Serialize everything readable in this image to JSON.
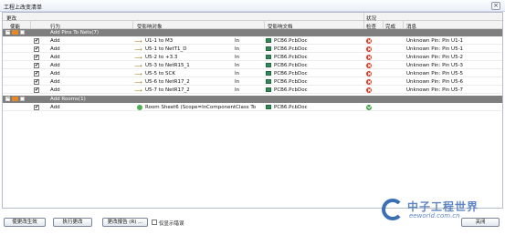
{
  "window": {
    "title": "工程上改变清单",
    "close": "×"
  },
  "header": {
    "modifications": "更改",
    "status": "状况",
    "columns": {
      "enable": "使能",
      "action": "行为",
      "affected_object": "受影响对象",
      "affected_document": "受影响文档",
      "check": "检查",
      "done": "完成",
      "message": "消息"
    }
  },
  "groups": [
    {
      "label": "Add Pins To Nets(7)",
      "toggle": "−",
      "rows": [
        {
          "enabled": "✔",
          "action": "Add",
          "object": "U1-1 to M3",
          "prep": "In",
          "document": "PCB6.PcbDoc",
          "message": "Unknown Pin: Pin U1-1"
        },
        {
          "enabled": "✔",
          "action": "Add",
          "object": "U5-1 to NetT1_D",
          "prep": "In",
          "document": "PCB6.PcbDoc",
          "message": "Unknown Pin: Pin U5-1"
        },
        {
          "enabled": "✔",
          "action": "Add",
          "object": "U5-2 to +3.3",
          "prep": "In",
          "document": "PCB6.PcbDoc",
          "message": "Unknown Pin: Pin U5-2"
        },
        {
          "enabled": "✔",
          "action": "Add",
          "object": "U5-3 to NetR15_1",
          "prep": "In",
          "document": "PCB6.PcbDoc",
          "message": "Unknown Pin: Pin U5-3"
        },
        {
          "enabled": "✔",
          "action": "Add",
          "object": "U5-5 to SCK",
          "prep": "In",
          "document": "PCB6.PcbDoc",
          "message": "Unknown Pin: Pin U5-5"
        },
        {
          "enabled": "✔",
          "action": "Add",
          "object": "U5-6 to NetR17_2",
          "prep": "In",
          "document": "PCB6.PcbDoc",
          "message": "Unknown Pin: Pin U5-6"
        },
        {
          "enabled": "✔",
          "action": "Add",
          "object": "U5-7 to NetR17_2",
          "prep": "In",
          "document": "PCB6.PcbDoc",
          "message": "Unknown Pin: Pin U5-7"
        }
      ]
    },
    {
      "label": "Add Rooms(1)",
      "toggle": "−",
      "rows": [
        {
          "enabled": "✔",
          "action": "Add",
          "object": "Room Sheet6 (Scope=InComponentClass To",
          "prep": "",
          "document": "PCB6.PcbDoc",
          "message": ""
        }
      ]
    }
  ],
  "buttons": {
    "validate": "使更改生效",
    "execute": "执行更改",
    "report": "更改报告 (R) ...",
    "errors_only": "仅显示错误",
    "close": "关闭"
  },
  "watermark": {
    "zh": "中子工程世界",
    "en": "eeworld.com.cn"
  },
  "colors": {
    "group_bar": "#7f7f7f",
    "error": "#d93a24",
    "ok": "#3da33d",
    "doc_icon": "#2e8b57",
    "watermark": "#5f86c4"
  }
}
